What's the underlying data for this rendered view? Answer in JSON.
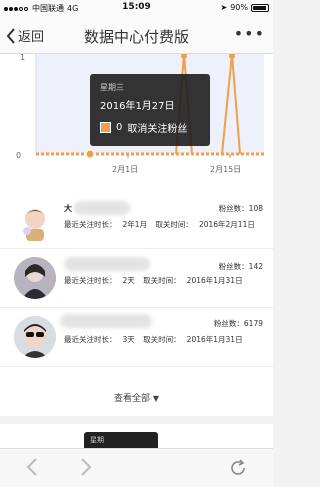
{
  "status_bar": {
    "carrier": "中国联通",
    "network": "4G",
    "time": "15:09",
    "battery": "90%"
  },
  "nav": {
    "back_label": "返回",
    "title": "数据中心付费版",
    "more_icon": "more-icon"
  },
  "chart_data": {
    "type": "line",
    "x_ticks": [
      "2月1日",
      "2月15日"
    ],
    "y_ticks": [
      "1",
      "0"
    ],
    "series_color": "#f0a04b",
    "tooltip": {
      "name": "星期三",
      "date": "2016年1月27日",
      "value": "0",
      "label": "取消关注粉丝"
    }
  },
  "followers": [
    {
      "name": "大",
      "fans_label": "粉丝数：",
      "fans": "108",
      "recent_label": "最近关注时长：",
      "recent": "2年1月",
      "cancel_label": "取关时间：",
      "cancel": "2016年2月11日"
    },
    {
      "name": "",
      "fans_label": "粉丝数：",
      "fans": "142",
      "recent_label": "最近关注时长：",
      "recent": "2天",
      "cancel_label": "取关时间：",
      "cancel": "2016年1月31日"
    },
    {
      "name": "",
      "fans_label": "粉丝数：",
      "fans": "6179",
      "recent_label": "最近关注时长：",
      "recent": "3天",
      "cancel_label": "取关时间：",
      "cancel": "2016年1月31日"
    }
  ],
  "view_all": "查看全部",
  "next_tooltip": "星期",
  "toolbar": {
    "back_icon": "chevron-left-icon",
    "forward_icon": "chevron-right-icon",
    "refresh_icon": "refresh-icon"
  }
}
